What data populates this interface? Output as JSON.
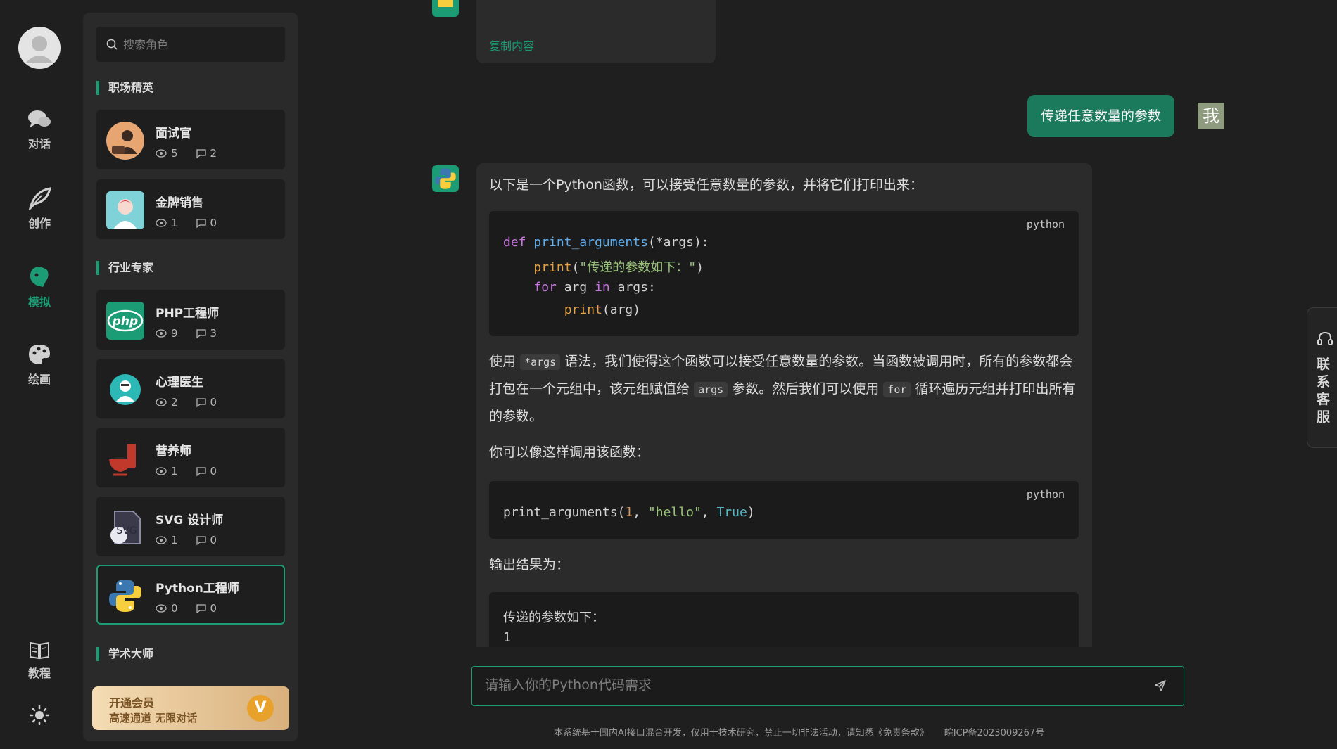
{
  "nav": {
    "items": [
      {
        "label": "对话",
        "icon": "chat-bubbles-icon"
      },
      {
        "label": "创作",
        "icon": "feather-icon"
      },
      {
        "label": "模拟",
        "icon": "mask-face-icon"
      },
      {
        "label": "绘画",
        "icon": "palette-icon"
      },
      {
        "label": "教程",
        "icon": "book-icon"
      }
    ],
    "active": "模拟",
    "theme_icon": "sun-icon"
  },
  "roles_panel": {
    "search_placeholder": "搜索角色",
    "sections": [
      {
        "title": "职场精英",
        "roles": [
          {
            "name": "面试官",
            "views": "5",
            "messages": "2"
          },
          {
            "name": "金牌销售",
            "views": "1",
            "messages": "0"
          }
        ]
      },
      {
        "title": "行业专家",
        "roles": [
          {
            "name": "PHP工程师",
            "views": "9",
            "messages": "3"
          },
          {
            "name": "心理医生",
            "views": "2",
            "messages": "0"
          },
          {
            "name": "营养师",
            "views": "1",
            "messages": "0"
          },
          {
            "name": "SVG 设计师",
            "views": "1",
            "messages": "0"
          },
          {
            "name": "Python工程师",
            "views": "0",
            "messages": "0",
            "selected": true
          }
        ]
      },
      {
        "title": "学术大师",
        "roles": []
      }
    ],
    "vip": {
      "title": "开通会员",
      "subtitle": "高速通道 无限对话",
      "badge": "V"
    }
  },
  "chat": {
    "prev_copy_label": "复制内容",
    "user_message": "传递任意数量的参数",
    "user_avatar": "我",
    "answer": {
      "intro": "以下是一个Python函数，可以接受任意数量的参数，并将它们打印出来：",
      "code1": {
        "lang": "python",
        "line1": {
          "kw": "def",
          "fn": "print_arguments",
          "rest": "(*args):"
        },
        "line2": {
          "fn": "print",
          "open": "(",
          "str": "\"传递的参数如下：\"",
          "close": ")"
        },
        "line3": {
          "kw1": "for",
          "v": "arg",
          "kw2": "in",
          "rest": "args:"
        },
        "line4": {
          "fn": "print",
          "rest": "(arg)"
        }
      },
      "para": {
        "t1": "使用",
        "c1": "*args",
        "t2": "语法，我们使得这个函数可以接受任意数量的参数。当函数被调用时，所有的参数都会打包在一个元组中，该元组赋值给",
        "c2": "args",
        "t3": "参数。然后我们可以使用",
        "c3": "for",
        "t4": "循环遍历元组并打印出所有的参数。"
      },
      "call_intro": "你可以像这样调用该函数：",
      "code2": {
        "lang": "python",
        "name": "print_arguments(",
        "num": "1",
        "sep1": ", ",
        "str": "\"hello\"",
        "sep2": ", ",
        "bool": "True",
        "close": ")"
      },
      "output_intro": "输出结果为：",
      "output": {
        "line1": "传递的参数如下：",
        "line2": "1"
      }
    }
  },
  "input": {
    "placeholder": "请输入你的Python代码需求"
  },
  "footer": {
    "disclaimer": "本系统基于国内AI接口混合开发，仅用于技术研究，禁止一切非法活动，请知悉《免责条款》",
    "icp": "皖ICP备2023009267号"
  },
  "customer_service": {
    "label": "联系客服",
    "icon": "headset-icon"
  },
  "colors": {
    "accent": "#1c9c74",
    "background": "#1f1f1f",
    "panel": "#2a2a2a",
    "user_bubble": "#1c7a5c"
  }
}
